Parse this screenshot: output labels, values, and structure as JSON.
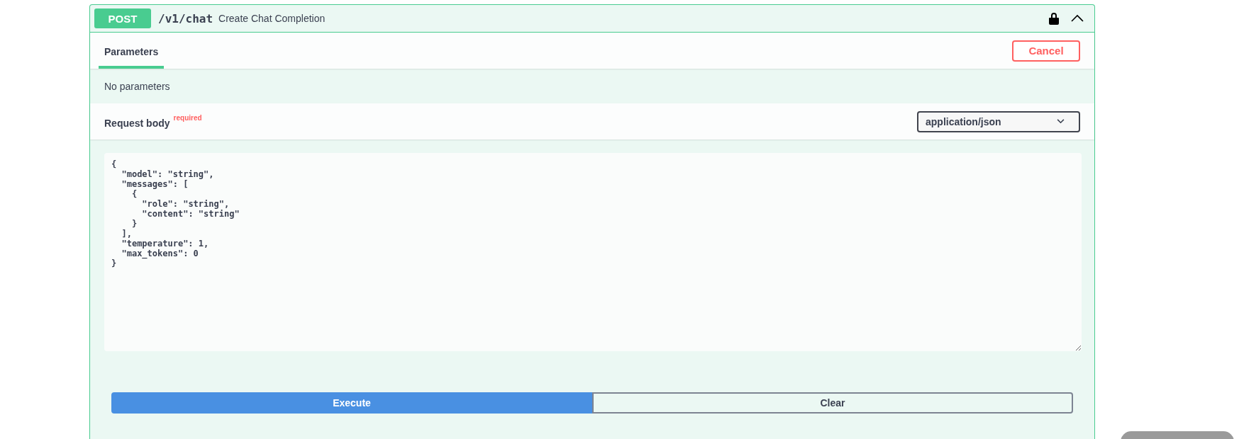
{
  "operation": {
    "method": "POST",
    "path": "/v1/chat",
    "summary": "Create Chat Completion",
    "locked": true,
    "expanded": true
  },
  "tabs": [
    {
      "label": "Parameters",
      "selected": true
    }
  ],
  "cancel_button": "Cancel",
  "parameters_message": "No parameters",
  "request_body": {
    "title": "Request body",
    "required_label": "required",
    "content_type": "application/json",
    "value": "{\n  \"model\": \"string\",\n  \"messages\": [\n    {\n      \"role\": \"string\",\n      \"content\": \"string\"\n    }\n  ],\n  \"temperature\": 1,\n  \"max_tokens\": 0\n}"
  },
  "actions": [
    {
      "label": "Execute",
      "kind": "primary"
    },
    {
      "label": "Clear",
      "kind": "secondary"
    }
  ]
}
